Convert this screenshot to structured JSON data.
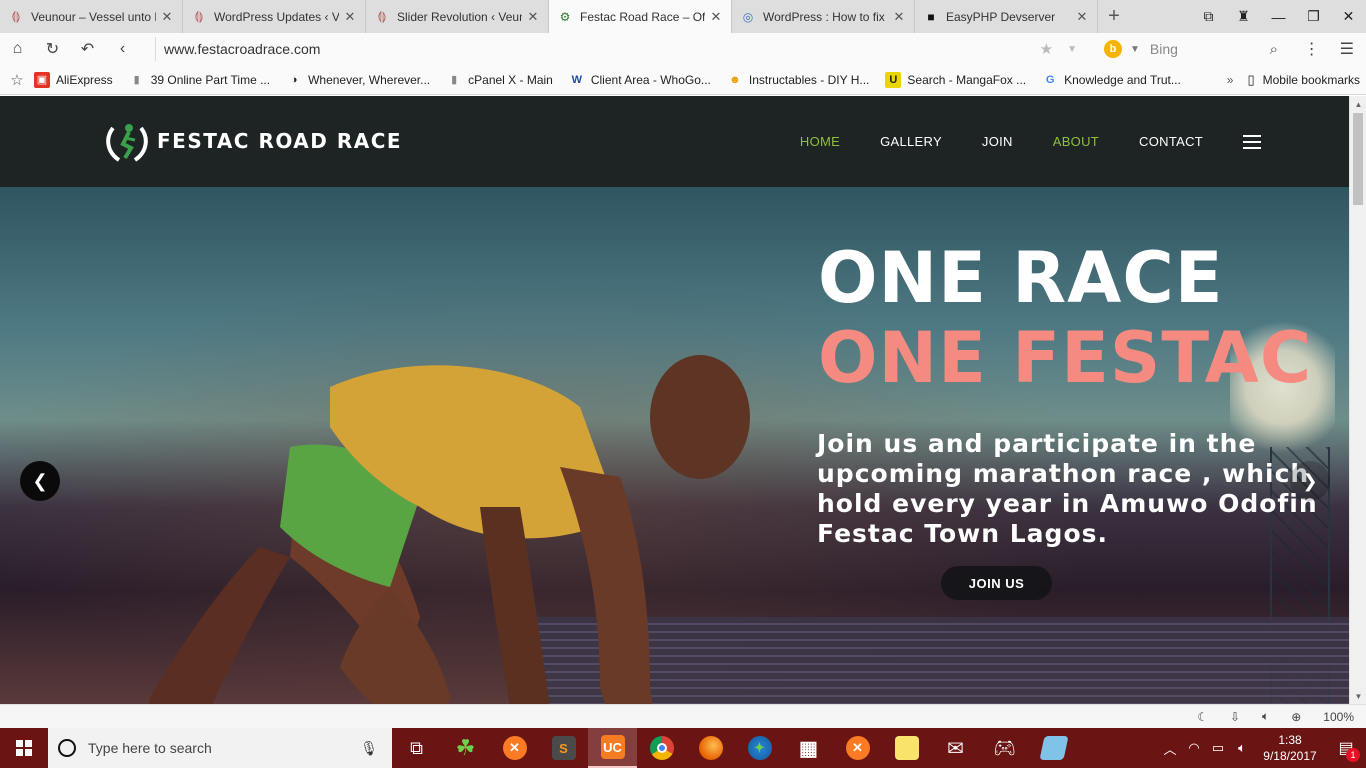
{
  "browser": {
    "tabs": [
      {
        "title": "Veunour – Vessel unto H",
        "active": false
      },
      {
        "title": "WordPress Updates ‹ Ve",
        "active": false
      },
      {
        "title": "Slider Revolution ‹ Veun",
        "active": false
      },
      {
        "title": "Festac Road Race – Offi",
        "active": true
      },
      {
        "title": "WordPress : How to fix '",
        "active": false
      },
      {
        "title": "EasyPHP Devserver",
        "active": false
      }
    ],
    "url": "www.festacroadrace.com",
    "search_engine": "Bing",
    "bookmarks": [
      "AliExpress",
      "39 Online Part Time ...",
      "Whenever, Wherever...",
      "cPanel X - Main",
      "Client Area - WhoGo...",
      "Instructables - DIY H...",
      "Search - MangaFox ...",
      "Knowledge and Trut..."
    ],
    "more_bookmarks": "»",
    "mobile_bookmarks": "Mobile bookmarks",
    "zoom": "100%"
  },
  "site": {
    "logo_text": "FESTAC ROAD RACE",
    "nav": {
      "home": "HOME",
      "gallery": "GALLERY",
      "join": "JOIN",
      "about": "ABOUT",
      "contact": "CONTACT"
    },
    "headline_line1": "ONE RACE",
    "headline_line2": "ONE FESTAC",
    "subtext": "Join us and participate in the upcoming marathon race , which hold every year in Amuwo Odofin Festac Town Lagos.",
    "cta": "JOIN US",
    "colors": {
      "nav_active": "#8fc03a",
      "headline_accent": "#f48a80",
      "nav_bg": "#1d2423"
    }
  },
  "taskbar": {
    "search_placeholder": "Type here to search",
    "time": "1:38",
    "date": "9/18/2017",
    "notification_count": "1"
  }
}
